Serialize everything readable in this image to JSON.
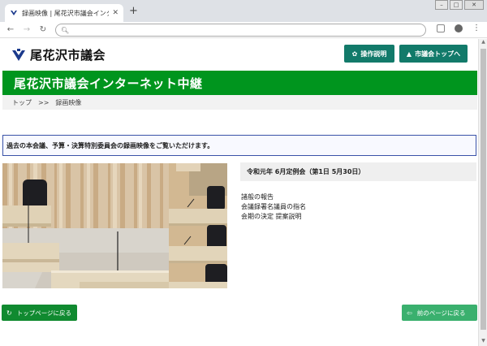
{
  "browser": {
    "tab_title": "録画映像 | 尾花沢市議会インタ",
    "new_tab": "+",
    "address": ""
  },
  "site": {
    "logo_text": "尾花沢市議会",
    "btn_help": "操作説明",
    "btn_top": "市議会トップへ",
    "banner_title": "尾花沢市議会インターネット中継",
    "breadcrumb": {
      "home": "トップ",
      "sep": ">>",
      "current": "録画映像"
    },
    "notice": "過去の本会議、予算・決算特別委員会の録画映像をご覧いただけます。",
    "session_title": "令和元年 6月定例会（第1日 5月30日）",
    "agenda": [
      "諸般の報告",
      "会議録署名議員の指名",
      "会期の決定 提案説明"
    ],
    "btn_page_top": "トップページに戻る",
    "btn_prev_page": "前のページに戻る"
  },
  "colors": {
    "banner": "#00951e",
    "header_button": "#127a6a",
    "notice_border": "#3a52a8"
  }
}
